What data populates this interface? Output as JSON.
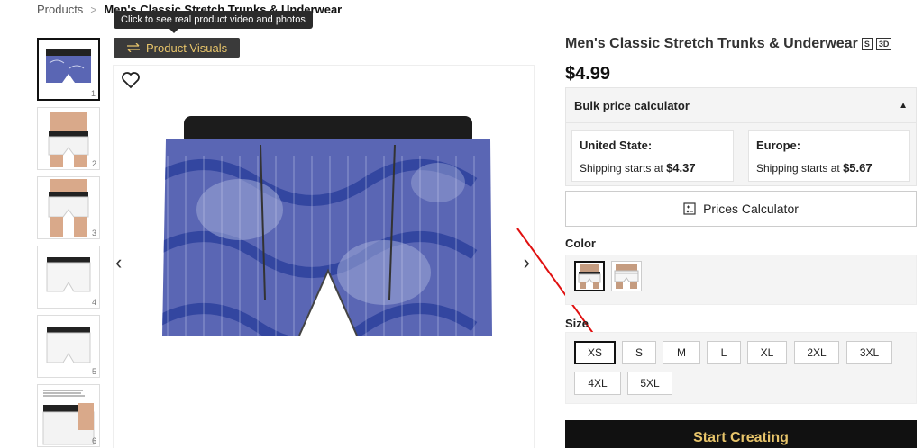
{
  "breadcrumb": {
    "root": "Products",
    "current": "Men's Classic Stretch Trunks & Underwear"
  },
  "tooltip": "Click to see real product video and photos",
  "visuals_button": "Product Visuals",
  "thumbnails": [
    "1",
    "2",
    "3",
    "4",
    "5",
    "6"
  ],
  "product": {
    "title": "Men's Classic Stretch Trunks & Underwear",
    "tags": [
      "S",
      "3D"
    ],
    "price": "$4.99"
  },
  "bulk": {
    "label": "Bulk price calculator"
  },
  "shipping": [
    {
      "region": "United State:",
      "text": "Shipping starts at",
      "amount": "$4.37"
    },
    {
      "region": "Europe:",
      "text": "Shipping starts at",
      "amount": "$5.67"
    }
  ],
  "calculator_label": "Prices Calculator",
  "color_label": "Color",
  "size_label": "Size",
  "sizes": [
    "XS",
    "S",
    "M",
    "L",
    "XL",
    "2XL",
    "3XL",
    "4XL",
    "5XL"
  ],
  "selected_size": "XS",
  "start_label": "Start Creating",
  "colors": {
    "accent": "#e7c46a",
    "dark": "#111111",
    "pattern": "#5a66b4"
  }
}
